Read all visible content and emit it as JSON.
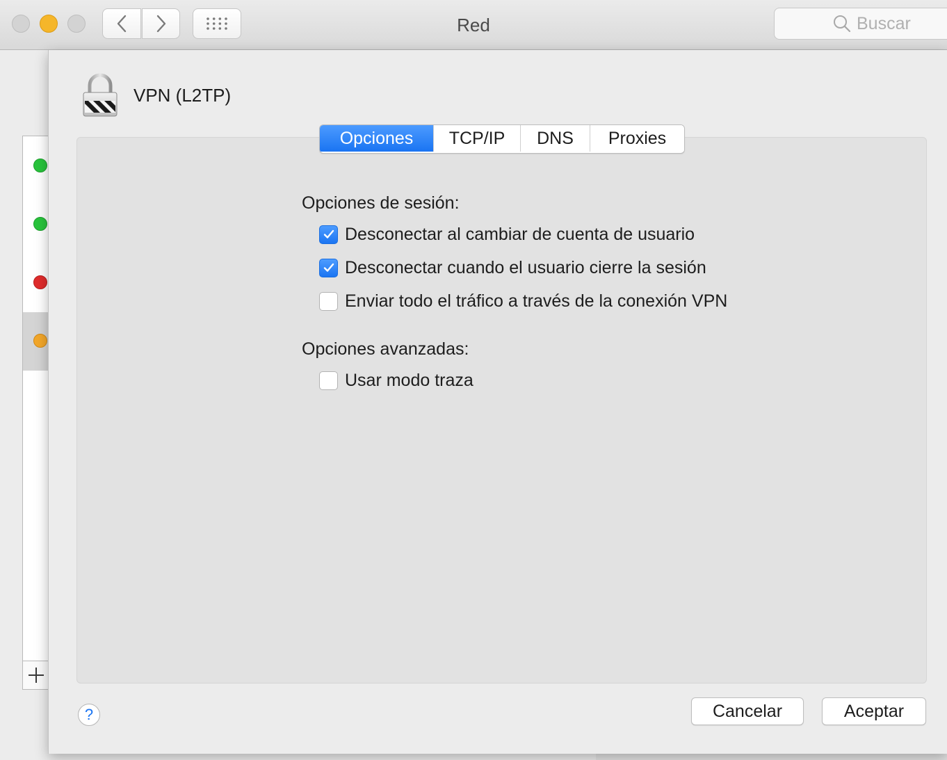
{
  "window": {
    "title": "Red"
  },
  "toolbar": {
    "search_placeholder": "Buscar"
  },
  "sidebar": {
    "status_dots": [
      {
        "status": "connected",
        "color": "#28c43c"
      },
      {
        "status": "connected",
        "color": "#28c43c"
      },
      {
        "status": "disconnected",
        "color": "#e02c2c"
      },
      {
        "status": "inactive",
        "color": "#f3a72a"
      }
    ],
    "add_symbol": "+"
  },
  "sheet": {
    "service_name": "VPN (L2TP)",
    "tabs": [
      {
        "label": "Opciones",
        "active": true
      },
      {
        "label": "TCP/IP",
        "active": false
      },
      {
        "label": "DNS",
        "active": false
      },
      {
        "label": "Proxies",
        "active": false
      }
    ],
    "session_options": {
      "heading": "Opciones de sesión:",
      "items": [
        {
          "label": "Desconectar al cambiar de cuenta de usuario",
          "checked": true
        },
        {
          "label": "Desconectar cuando el usuario cierre la sesión",
          "checked": true
        },
        {
          "label": "Enviar todo el tráfico a través de la conexión VPN",
          "checked": false
        }
      ]
    },
    "advanced_options": {
      "heading": "Opciones avanzadas:",
      "items": [
        {
          "label": "Usar modo traza",
          "checked": false
        }
      ]
    },
    "help_label": "?",
    "cancel_label": "Cancelar",
    "ok_label": "Aceptar"
  },
  "colors": {
    "accent": "#1a74f2"
  }
}
